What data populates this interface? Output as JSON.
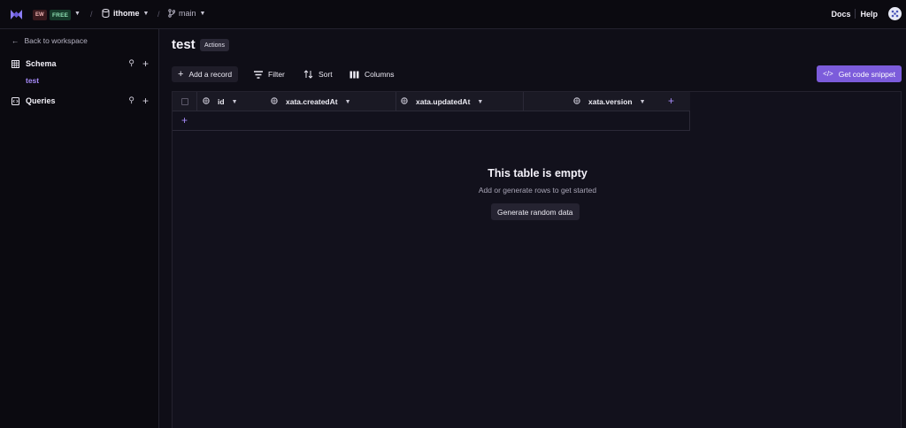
{
  "topbar": {
    "workspace_initials": "EW",
    "plan": "FREE",
    "database": "ithome",
    "branch": "main",
    "docs": "Docs",
    "help": "Help"
  },
  "sidebar": {
    "back_label": "Back to workspace",
    "schema_label": "Schema",
    "table_name": "test",
    "queries_label": "Queries"
  },
  "main": {
    "title": "test",
    "actions_label": "Actions",
    "toolbar": {
      "add_record": "Add a record",
      "filter": "Filter",
      "sort": "Sort",
      "columns": "Columns",
      "code_snippet": "Get code snippet"
    },
    "columns": [
      "id",
      "xata.createdAt",
      "xata.updatedAt",
      "xata.version"
    ],
    "empty": {
      "title": "This table is empty",
      "subtitle": "Add or generate rows to get started",
      "button": "Generate random data"
    }
  },
  "colors": {
    "accent": "#7c5cdb",
    "accent_text": "#a78bfa",
    "background": "#0f0e17"
  }
}
